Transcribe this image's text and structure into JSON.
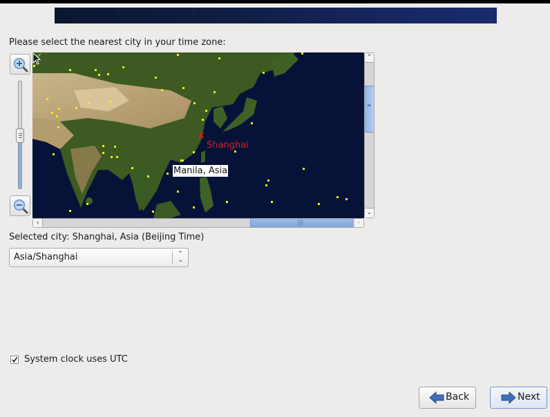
{
  "header": {
    "banner": "installer-banner"
  },
  "prompt": "Please select the nearest city in your time zone:",
  "map": {
    "zoom_in_icon": "zoom-in-icon",
    "zoom_out_icon": "zoom-out-icon",
    "zoom_level_fraction": 0.5,
    "selected_city_marker": "x",
    "selected_city_label": "Shanghai",
    "hover_label": "Manila, Asia",
    "vertical_scroll_fraction": 0.3,
    "horizontal_scroll_fraction": 0.68,
    "colors": {
      "selected": "#d91e1e",
      "city_dot": "#f2ef16",
      "hover_marker": "#3fcf3f",
      "ocean": "#071238"
    }
  },
  "selected_city_text": "Selected city: Shanghai, Asia (Beijing Time)",
  "timezone_select": {
    "value": "Asia/Shanghai"
  },
  "utc_checkbox": {
    "label": "System clock uses UTC",
    "checked": true
  },
  "buttons": {
    "back": "Back",
    "next": "Next"
  }
}
